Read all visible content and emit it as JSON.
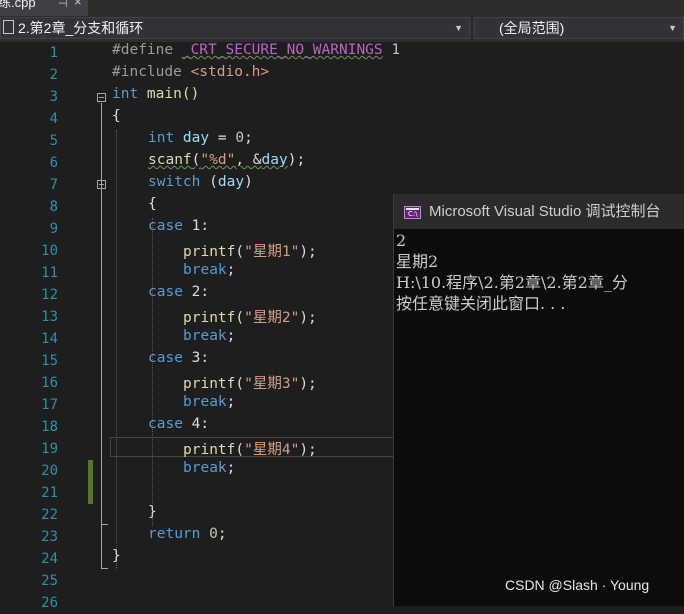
{
  "tab": {
    "title": "练.cpp",
    "pin_glyph": "⊣",
    "close_glyph": "×"
  },
  "nav": {
    "project": "2.第2章_分支和循环",
    "scope": "(全局范围)"
  },
  "editor": {
    "line_numbers": [
      "1",
      "2",
      "3",
      "4",
      "5",
      "6",
      "7",
      "8",
      "9",
      "10",
      "11",
      "12",
      "13",
      "14",
      "15",
      "16",
      "17",
      "18",
      "19",
      "20",
      "21",
      "22",
      "23",
      "24",
      "25",
      "26"
    ],
    "lines": {
      "l1a": "#define ",
      "l1b": "_CRT_SECURE_NO_WARNINGS",
      "l1c": " 1",
      "l2a": "#include ",
      "l2b": "<stdio.h>",
      "l3a": "int",
      "l3b": " main()",
      "l4": "{",
      "l5a": "int",
      "l5b": " day",
      "l5c": " = ",
      "l5d": "0",
      "l5e": ";",
      "l6a": "scanf",
      "l6b": "(",
      "l6c": "\"%d\"",
      "l6d": ", &",
      "l6e": "day",
      "l6f": ");",
      "l7a": "switch",
      "l7b": " (",
      "l7c": "day",
      "l7d": ")",
      "l8": "{",
      "l9a": "case",
      "l9b": " 1:",
      "l10a": "printf",
      "l10b": "(",
      "l10c": "\"星期1\"",
      "l10d": ");",
      "l11a": "break",
      "l11b": ";",
      "l12a": "case",
      "l12b": " 2:",
      "l13a": "printf",
      "l13b": "(",
      "l13c": "\"星期2\"",
      "l13d": ");",
      "l14a": "break",
      "l14b": ";",
      "l15a": "case",
      "l15b": " 3:",
      "l16a": "printf",
      "l16b": "(",
      "l16c": "\"星期3\"",
      "l16d": ");",
      "l17a": "break",
      "l17b": ";",
      "l18a": "case",
      "l18b": " 4:",
      "l19a": "printf",
      "l19b": "(",
      "l19c": "\"星期4\"",
      "l19d": ");",
      "l20a": "break",
      "l20b": ";",
      "l22": "}",
      "l23a": "return",
      "l23b": " ",
      "l23c": "0",
      "l23d": ";",
      "l24": "}"
    }
  },
  "console": {
    "title": "Microsoft Visual Studio 调试控制台",
    "icon_text": "C:\\",
    "output": [
      "2",
      "星期2",
      "H:\\10.程序\\2.第2章\\2.第2章_分",
      "按任意键关闭此窗口. . ."
    ]
  },
  "watermark": "CSDN @Slash · Young",
  "colors": {
    "background": "#1e1e1e",
    "keyword": "#569cd6",
    "string": "#d69d85",
    "number": "#b5cea8",
    "function": "#dcdcaa",
    "variable": "#9cdcfe",
    "macro": "#bd63c5",
    "line_number": "#2b91af",
    "change_bar": "#577430"
  }
}
